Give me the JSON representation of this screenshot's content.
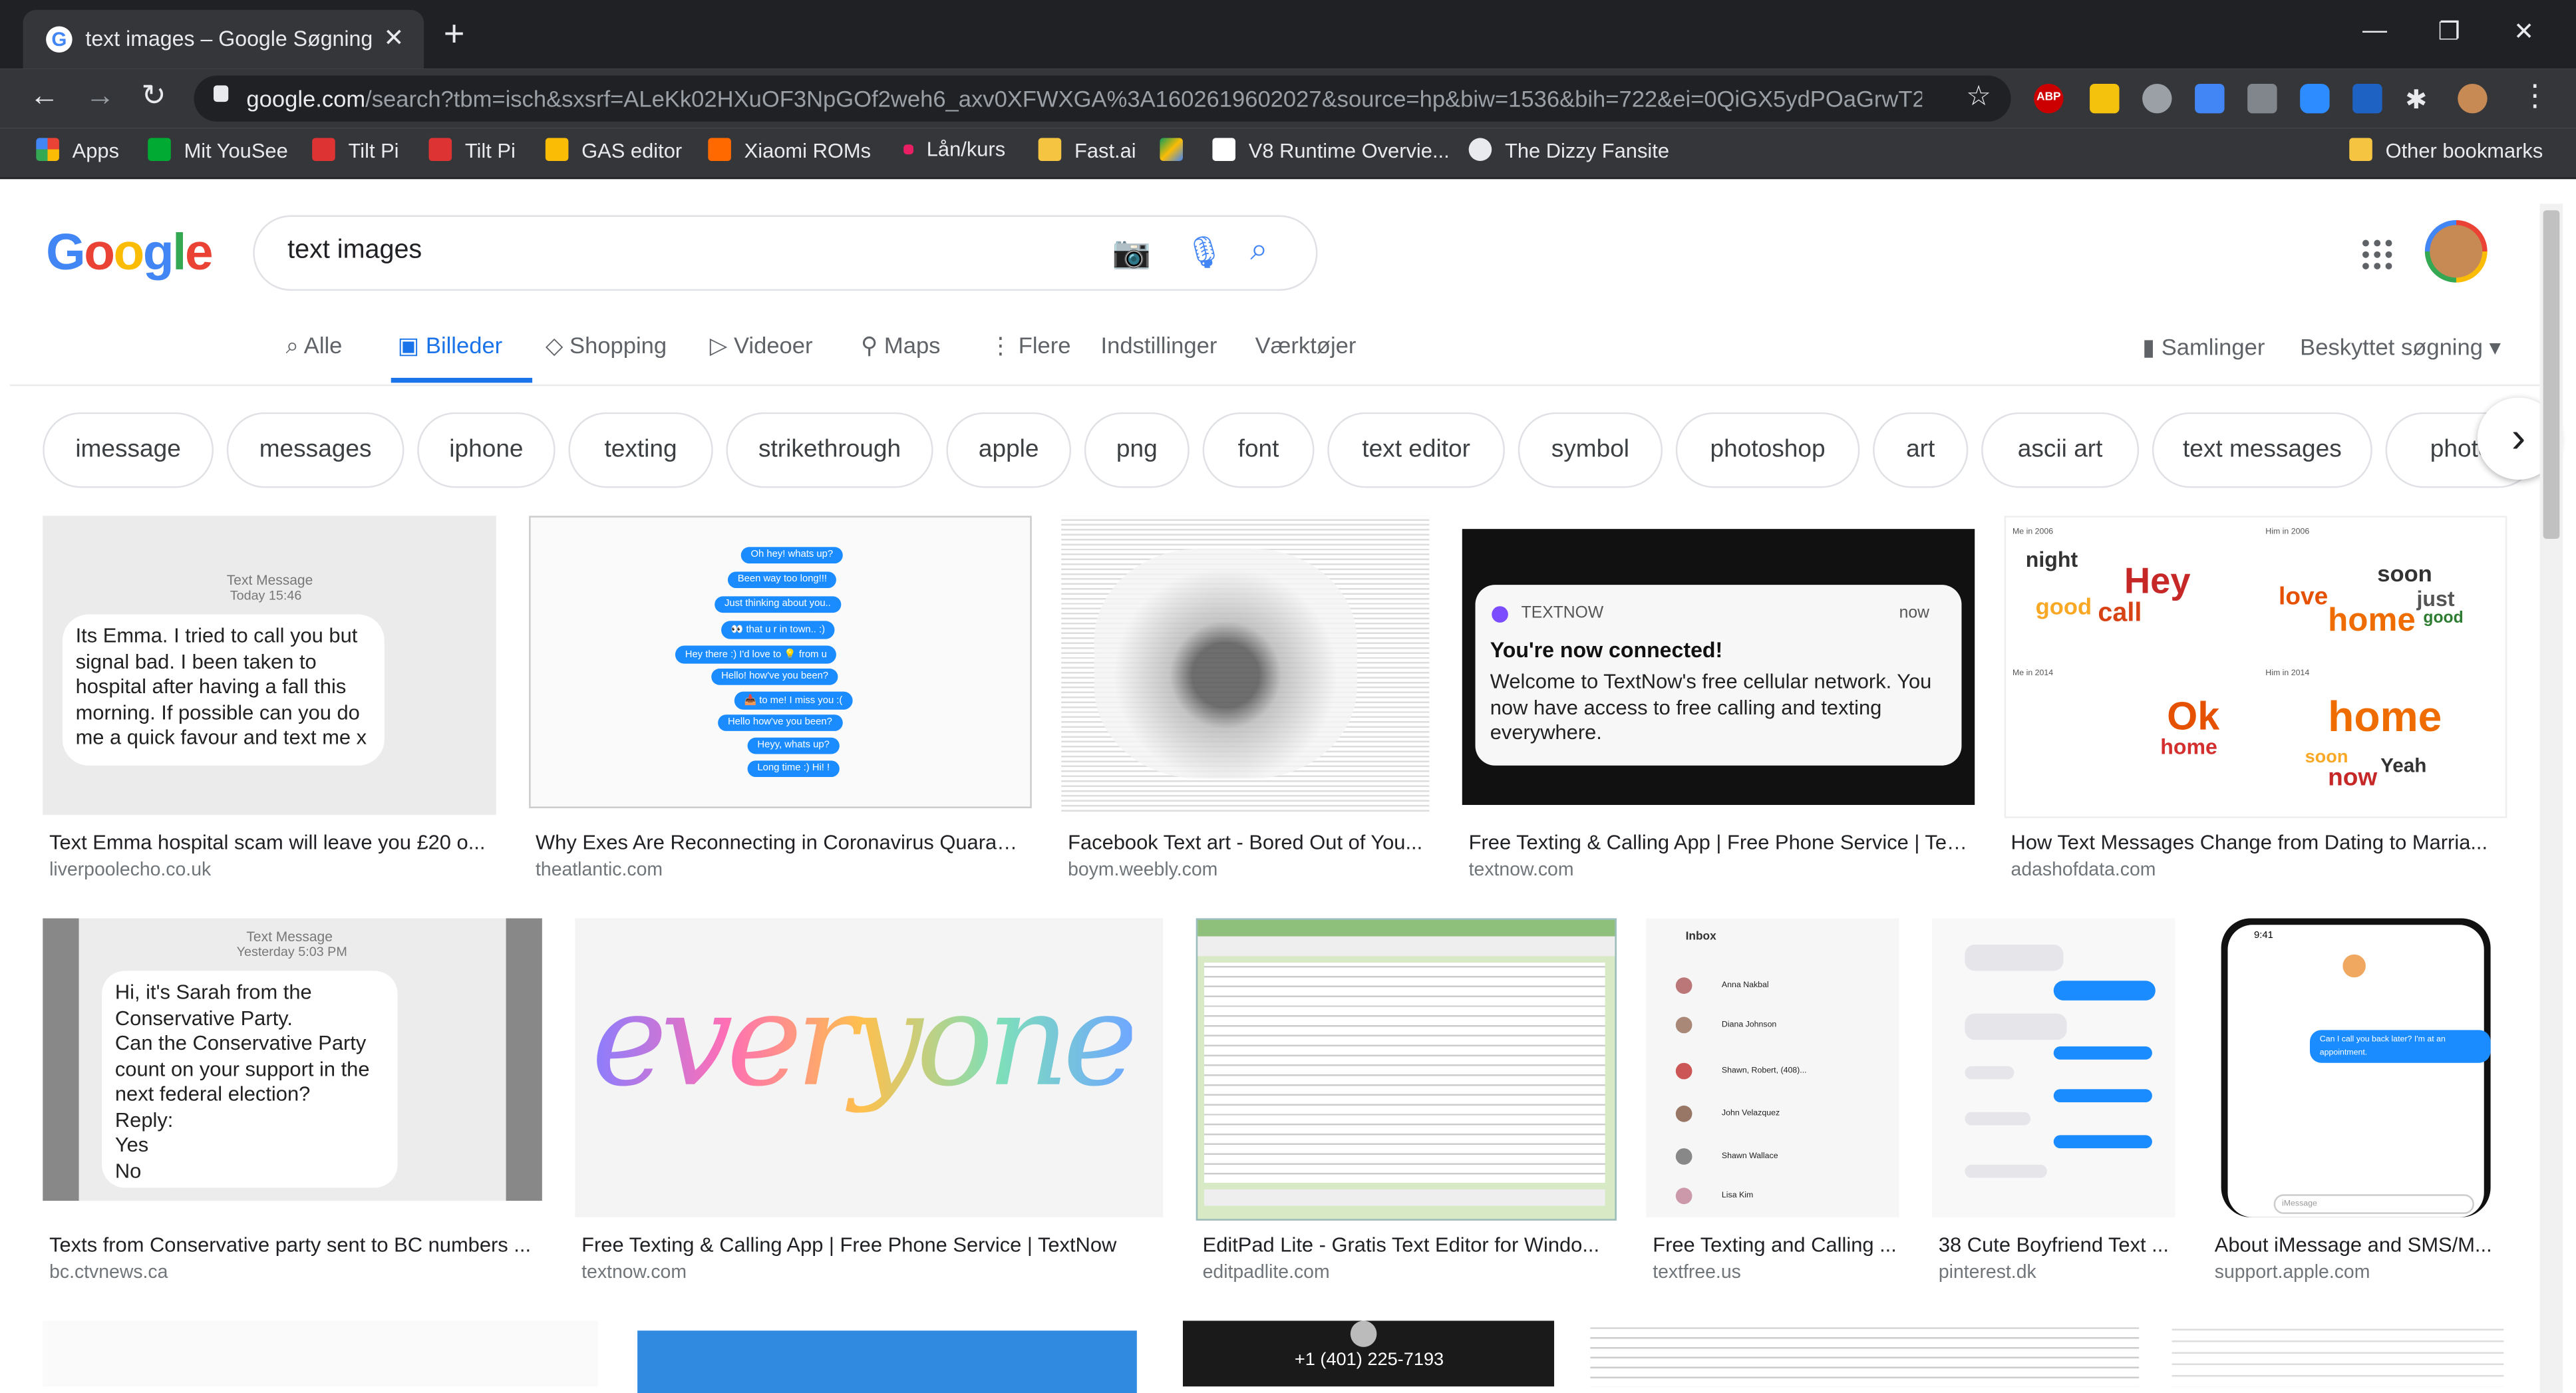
{
  "browser": {
    "tab_title": "text images – Google Søgning",
    "tab_close": "✕",
    "new_tab": "+",
    "url_host": "google.com",
    "url_rest": "/search?tbm=isch&sxsrf=ALeKk02HXuOF3NpGOf2weh6_axv0XFWXGA%3A1602619602027&source=hp&biw=1536&bih=722&ei=0QiGX5ydPOaGrwT2...",
    "ext_abp": "ABP",
    "bookmarks": [
      "Apps",
      "Mit YouSee",
      "Tilt Pi",
      "Tilt Pi",
      "GAS editor",
      "Xiaomi ROMs",
      "Lån/kurs",
      "Fast.ai",
      "",
      "V8 Runtime Overvie...",
      "The Dizzy Fansite"
    ],
    "other_bookmarks": "Other bookmarks"
  },
  "google": {
    "logo": [
      "G",
      "o",
      "o",
      "g",
      "l",
      "e"
    ],
    "logo_colors": [
      "#4285f4",
      "#ea4335",
      "#fbbc05",
      "#4285f4",
      "#34a853",
      "#ea4335"
    ],
    "query": "text images",
    "tabs": [
      "Alle",
      "Billeder",
      "Shopping",
      "Videoer",
      "Maps",
      "Flere",
      "Indstillinger",
      "Værktøjer"
    ],
    "active_tab": "Billeder",
    "right_tabs": [
      "Samlinger",
      "Beskyttet søgning"
    ],
    "chips": [
      "imessage",
      "messages",
      "iphone",
      "texting",
      "strikethrough",
      "apple",
      "png",
      "font",
      "text editor",
      "symbol",
      "photoshop",
      "art",
      "ascii art",
      "text messages",
      "photo"
    ]
  },
  "results": [
    {
      "caption": "Text Emma hospital scam will leave you £20 o...",
      "source": "liverpoolecho.co.uk",
      "header": "Text Message",
      "time": "Today 15:46",
      "body": "Its Emma. I tried to call you but signal bad. I been taken to hospital after having a fall this morning. If possible can you do me a quick favour and text me x"
    },
    {
      "caption": "Why Exes Are Reconnecting in Coronavirus Quarant...",
      "source": "theatlantic.com",
      "bubbles": [
        "Oh hey! whats up?",
        "Been way too long!!!",
        "Just thinking about you..",
        "👀 that u r in town.. :)",
        "Hey there :) I'd love to 💡 from u",
        "Hello! how've you been?",
        "📥 to me! I miss you :(",
        "Hello how've you been?",
        "Heyy, whats up?",
        "Long time :) Hi! !"
      ]
    },
    {
      "caption": "Facebook Text art - Bored Out of You...",
      "source": "boym.weebly.com"
    },
    {
      "caption": "Free Texting & Calling App | Free Phone Service | Tex...",
      "source": "textnow.com",
      "app": "TEXTNOW",
      "when": "now",
      "title": "You're now connected!",
      "body": "Welcome to TextNow's free cellular network. You now have access to free calling and texting everywhere."
    },
    {
      "caption": "How Text Messages Change from Dating to Marria...",
      "source": "adashofdata.com",
      "labels": [
        "Me in 2006",
        "Him in 2006",
        "Me in 2014",
        "Him in 2014"
      ],
      "words": [
        "night",
        "Hey",
        "good",
        "call",
        "soon",
        "love",
        "home",
        "just",
        "good",
        "Ok",
        "home",
        "home",
        "soon",
        "now",
        "Yeah"
      ]
    },
    {
      "caption": "Texts from Conservative party sent to BC numbers ...",
      "source": "bc.ctvnews.ca",
      "header": "Text Message",
      "time": "Yesterday 5:03 PM",
      "lines": [
        "Hi, it's Sarah from the",
        "Conservative Party.",
        "Can the Conservative Party",
        "count on your support in the",
        "next federal election?",
        "Reply:",
        "Yes",
        "No"
      ]
    },
    {
      "caption": "Free Texting & Calling App | Free Phone Service | TextNow",
      "source": "textnow.com",
      "art": "everyone"
    },
    {
      "caption": "EditPad Lite - Gratis Text Editor for Windo...",
      "source": "editpadlite.com"
    },
    {
      "caption": "Free Texting and Calling ...",
      "source": "textfree.us",
      "inbox": "Inbox",
      "contacts": [
        "Anna Nakbal",
        "Diana Johnson",
        "Shawn, Robert, (408)...",
        "John Velazquez",
        "Shawn Wallace",
        "Lisa Kim"
      ]
    },
    {
      "caption": "38 Cute Boyfriend Text ...",
      "source": "pinterest.dk"
    },
    {
      "caption": "About iMessage and SMS/M...",
      "source": "support.apple.com",
      "time": "9:41",
      "msg": "Can I call you back later? I'm at an appointment.",
      "input": "iMessage"
    }
  ],
  "row3": {
    "phone": "+1 (401) 225-7193"
  }
}
